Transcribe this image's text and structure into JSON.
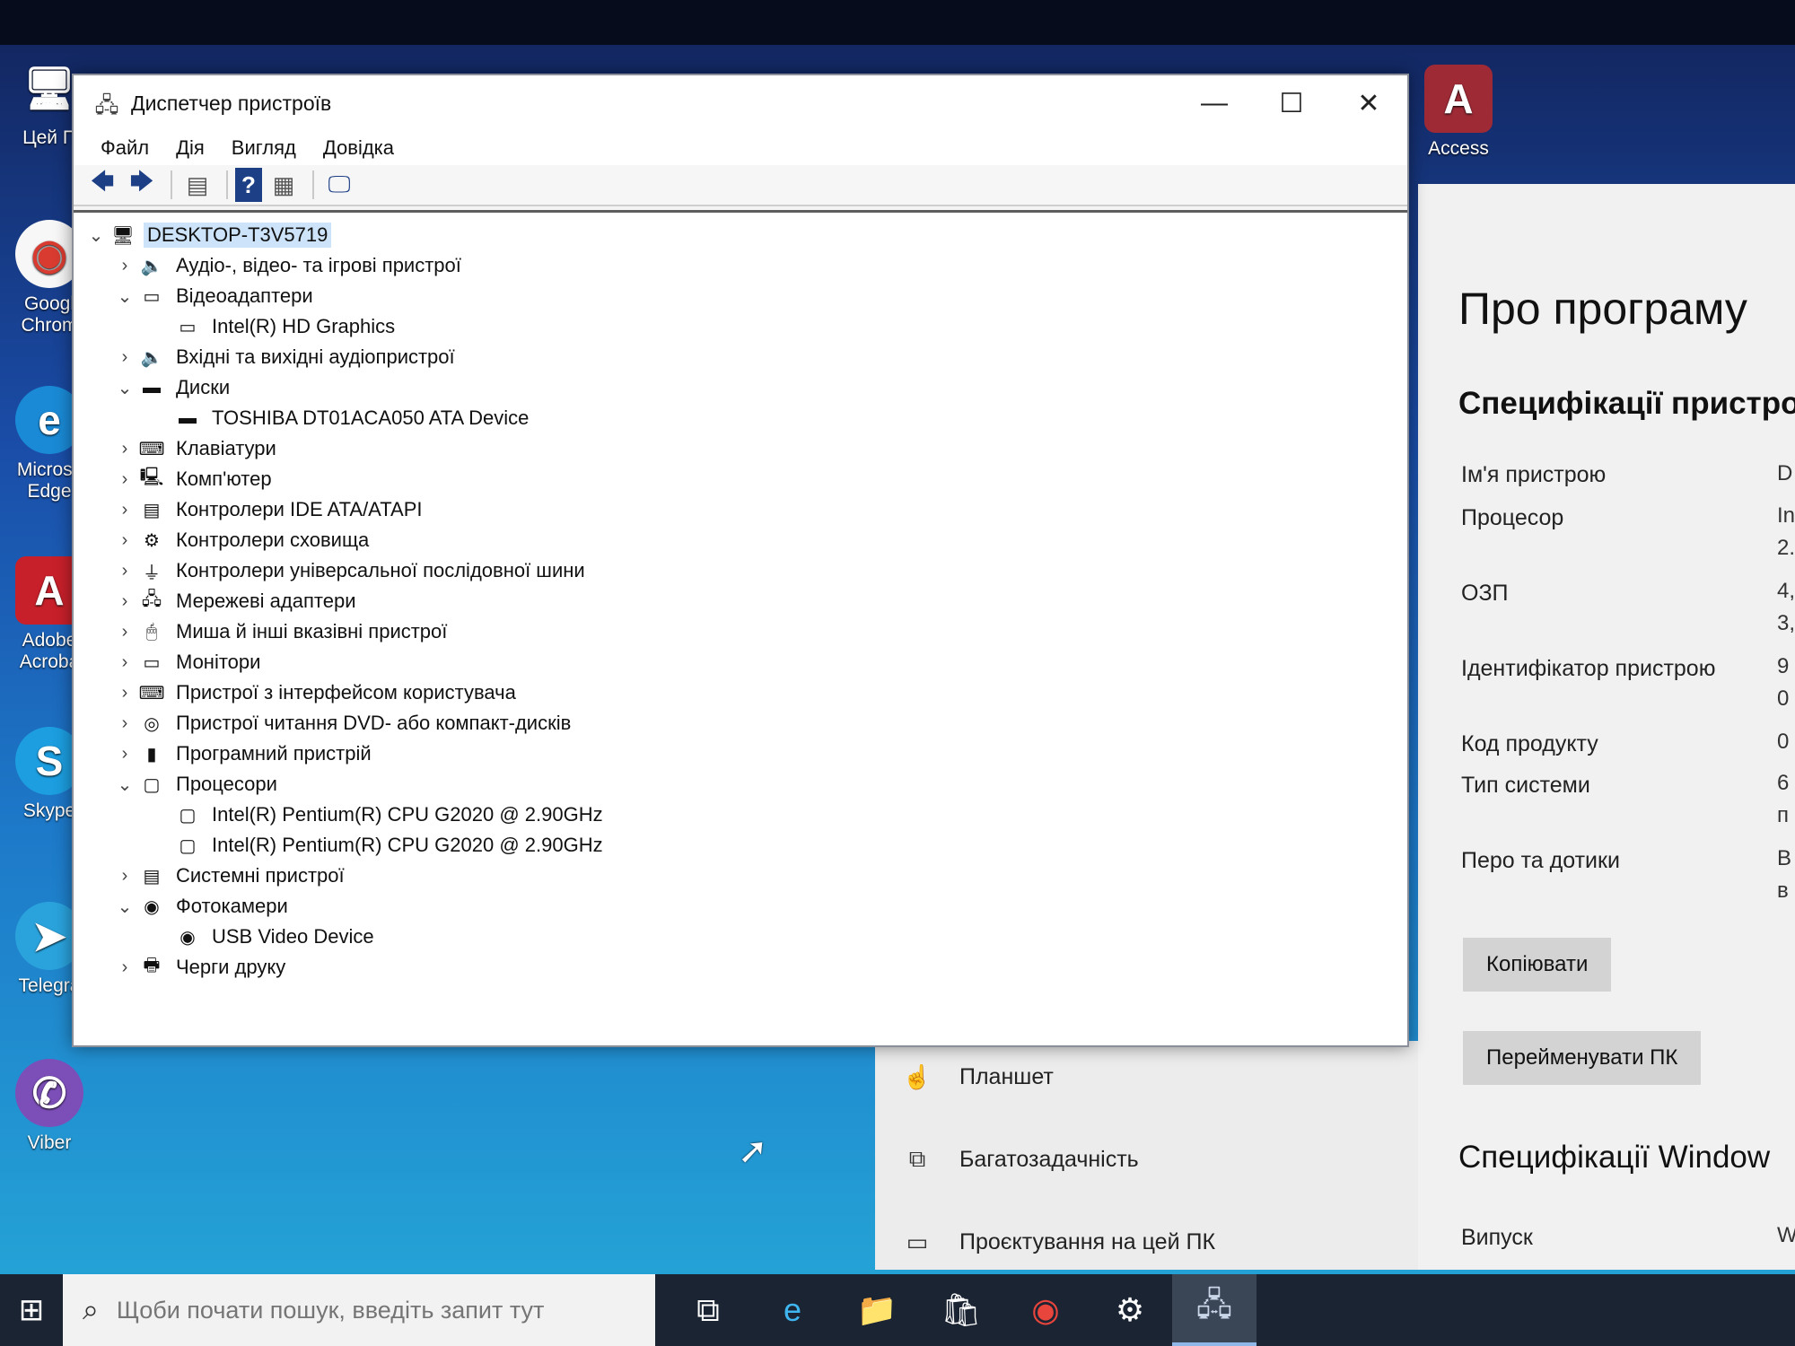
{
  "desktop": {
    "icons": [
      {
        "label": "Цей П",
        "glyph": "🖥",
        "color": "#3a76c8"
      },
      {
        "label": "Googl Chrom",
        "glyph": "◉",
        "color": "#d93b30"
      },
      {
        "label": "Microsc Edge",
        "glyph": "e",
        "color": "#1a8ad6"
      },
      {
        "label": "Adobe Acroba",
        "glyph": "A",
        "color": "#c8202a"
      },
      {
        "label": "Skype",
        "glyph": "S",
        "color": "#1c9ee0"
      },
      {
        "label": "Telegra",
        "glyph": "➤",
        "color": "#2aa3dd"
      },
      {
        "label": "Viber",
        "glyph": "✆",
        "color": "#7c4fb8"
      },
      {
        "label": "Access",
        "glyph": "A",
        "color": "#9e2a36"
      }
    ]
  },
  "device_manager": {
    "title": "Диспетчер пристроїв",
    "menu": [
      "Файл",
      "Дія",
      "Вигляд",
      "Довідка"
    ],
    "window_buttons": {
      "minimize": "—",
      "maximize": "☐",
      "close": "✕"
    },
    "toolbar_icons": [
      "back-arrow-icon",
      "forward-arrow-icon",
      "properties-icon",
      "help-icon",
      "view-icon",
      "monitor-icon"
    ],
    "tree": [
      {
        "level": 0,
        "expander": "⌄",
        "label": "DESKTOP-T3V5719",
        "icon": "🖥",
        "root": true
      },
      {
        "level": 1,
        "expander": "›",
        "label": "Аудіо-, відео- та ігрові пристрої",
        "icon": "🔈"
      },
      {
        "level": 1,
        "expander": "⌄",
        "label": "Відеоадаптери",
        "icon": "▭"
      },
      {
        "level": 2,
        "expander": "",
        "label": "Intel(R) HD Graphics",
        "icon": "▭"
      },
      {
        "level": 1,
        "expander": "›",
        "label": "Вхідні та вихідні аудіопристрої",
        "icon": "🔈"
      },
      {
        "level": 1,
        "expander": "⌄",
        "label": "Диски",
        "icon": "▬"
      },
      {
        "level": 2,
        "expander": "",
        "label": "TOSHIBA DT01ACA050 ATA Device",
        "icon": "▬"
      },
      {
        "level": 1,
        "expander": "›",
        "label": "Клавіатури",
        "icon": "⌨"
      },
      {
        "level": 1,
        "expander": "›",
        "label": "Комп'ютер",
        "icon": "🖳"
      },
      {
        "level": 1,
        "expander": "›",
        "label": "Контролери IDE ATA/ATAPI",
        "icon": "▤"
      },
      {
        "level": 1,
        "expander": "›",
        "label": "Контролери сховища",
        "icon": "⚙"
      },
      {
        "level": 1,
        "expander": "›",
        "label": "Контролери універсальної послідовної шини",
        "icon": "⏚"
      },
      {
        "level": 1,
        "expander": "›",
        "label": "Мережеві адаптери",
        "icon": "🖧"
      },
      {
        "level": 1,
        "expander": "›",
        "label": "Миша й інші вказівні пристрої",
        "icon": "🖱"
      },
      {
        "level": 1,
        "expander": "›",
        "label": "Монітори",
        "icon": "▭"
      },
      {
        "level": 1,
        "expander": "›",
        "label": "Пристрої з інтерфейсом користувача",
        "icon": "⌨"
      },
      {
        "level": 1,
        "expander": "›",
        "label": "Пристрої читання DVD- або компакт-дисків",
        "icon": "◎"
      },
      {
        "level": 1,
        "expander": "›",
        "label": "Програмний пристрій",
        "icon": "▮"
      },
      {
        "level": 1,
        "expander": "⌄",
        "label": "Процесори",
        "icon": "▢"
      },
      {
        "level": 2,
        "expander": "",
        "label": "Intel(R) Pentium(R) CPU G2020 @ 2.90GHz",
        "icon": "▢"
      },
      {
        "level": 2,
        "expander": "",
        "label": "Intel(R) Pentium(R) CPU G2020 @ 2.90GHz",
        "icon": "▢"
      },
      {
        "level": 1,
        "expander": "›",
        "label": "Системні пристрої",
        "icon": "▤"
      },
      {
        "level": 1,
        "expander": "⌄",
        "label": "Фотокамери",
        "icon": "◉"
      },
      {
        "level": 2,
        "expander": "",
        "label": "USB Video Device",
        "icon": "◉"
      },
      {
        "level": 1,
        "expander": "›",
        "label": "Черги друку",
        "icon": "🖶"
      }
    ]
  },
  "settings": {
    "nav": [
      {
        "label": "Планшет",
        "icon": "☝"
      },
      {
        "label": "Багатозадачність",
        "icon": "⧉"
      },
      {
        "label": "Проєктування на цей ПК",
        "icon": "▭"
      }
    ],
    "about_title": "Про програму",
    "device_specs_heading": "Специфікації пристро",
    "specs": [
      {
        "label": "Ім'я пристрою",
        "value": "D"
      },
      {
        "label": "Процесор",
        "value": "In\n2."
      },
      {
        "label": "ОЗП",
        "value": "4,\n3,"
      },
      {
        "label": "Ідентифікатор пристрою",
        "value": "9\n0"
      },
      {
        "label": "Код продукту",
        "value": "0"
      },
      {
        "label": "Тип системи",
        "value": "6\nп"
      },
      {
        "label": "Перо та дотики",
        "value": "В\nв"
      }
    ],
    "copy_button": "Копіювати",
    "rename_button": "Перейменувати ПК",
    "windows_specs_heading": "Специфікації Window",
    "edition_label": "Випуск",
    "edition_value": "W"
  },
  "taskbar": {
    "start_icon": "windows-start-icon",
    "search_placeholder": "Щоби почати пошук, введіть запит тут",
    "apps": [
      {
        "name": "task-view-icon",
        "glyph": "⧉",
        "color": "#ffffff"
      },
      {
        "name": "edge-icon",
        "glyph": "e",
        "color": "#3fb6f0"
      },
      {
        "name": "file-explorer-icon",
        "glyph": "📁",
        "color": "#f2c14e"
      },
      {
        "name": "store-icon",
        "glyph": "🛍",
        "color": "#ffffff"
      },
      {
        "name": "chrome-icon",
        "glyph": "◉",
        "color": "#e8453c"
      },
      {
        "name": "settings-icon",
        "glyph": "⚙",
        "color": "#ffffff"
      },
      {
        "name": "device-manager-icon",
        "glyph": "🖧",
        "color": "#c9d6e8"
      }
    ]
  }
}
